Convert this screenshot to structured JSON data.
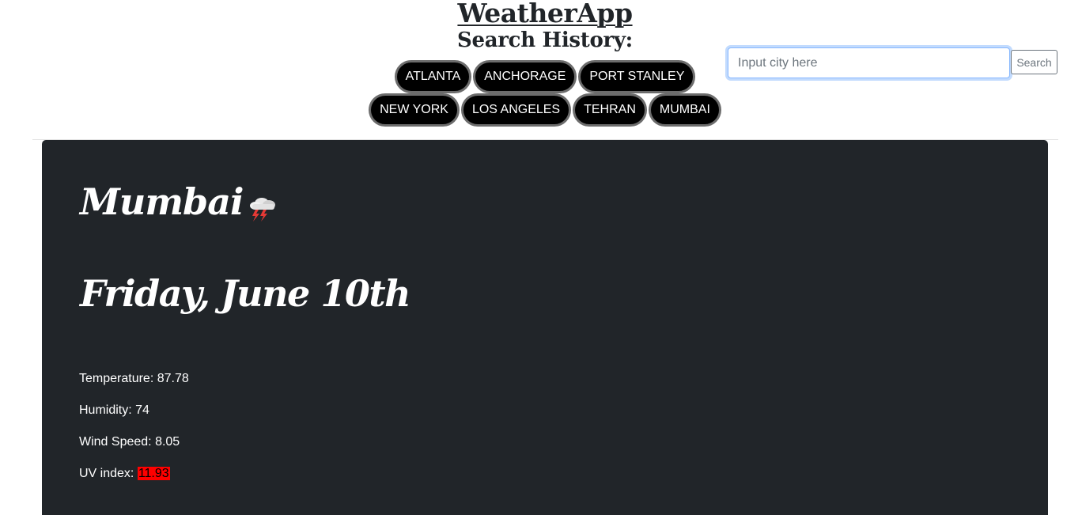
{
  "header": {
    "app_title": "WeatherApp",
    "history_title": "Search History:"
  },
  "search_history": {
    "row1": [
      "ATLANTA",
      "ANCHORAGE",
      "PORT STANLEY"
    ],
    "row2": [
      "NEW YORK",
      "LOS ANGELES",
      "TEHRAN",
      "MUMBAI"
    ]
  },
  "search": {
    "placeholder": "Input city here",
    "button_label": "Search"
  },
  "weather": {
    "city": "Mumbai",
    "icon": "thunderstorm-icon",
    "date": "Friday, June 10th",
    "temperature_label": "Temperature: ",
    "temperature": "87.78",
    "humidity_label": "Humidity: ",
    "humidity": "74",
    "wind_label": "Wind Speed: ",
    "wind_speed": "8.05",
    "uv_label": "UV index: ",
    "uv_index": "11.93",
    "uv_color": "#ff0000"
  },
  "colors": {
    "card_background": "#212529",
    "history_button_bg": "#000000",
    "history_button_border": "#6c6c6c",
    "focus_border": "#86b7fe"
  }
}
